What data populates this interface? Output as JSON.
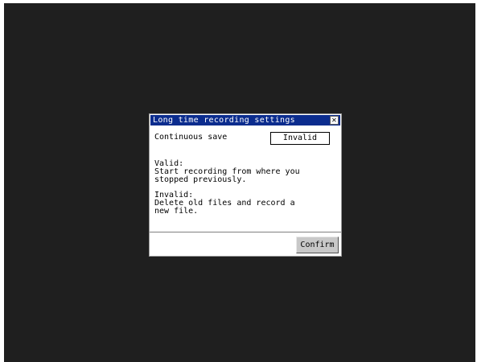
{
  "dialog": {
    "title": "Long time recording settings",
    "close_glyph": "✕",
    "setting": {
      "label": "Continuous save",
      "value": "Invalid"
    },
    "valid": {
      "heading": "Valid:",
      "line1": "Start recording from where you",
      "line2": "stopped previously."
    },
    "invalid": {
      "heading": "Invalid:",
      "line1": "Delete old files and record a",
      "line2": "new file."
    },
    "confirm_label": "Confirm"
  },
  "colors": {
    "screen_background": "#1f1f1f",
    "titlebar": "#0b2c8e",
    "button_face": "#c8c8c8"
  }
}
